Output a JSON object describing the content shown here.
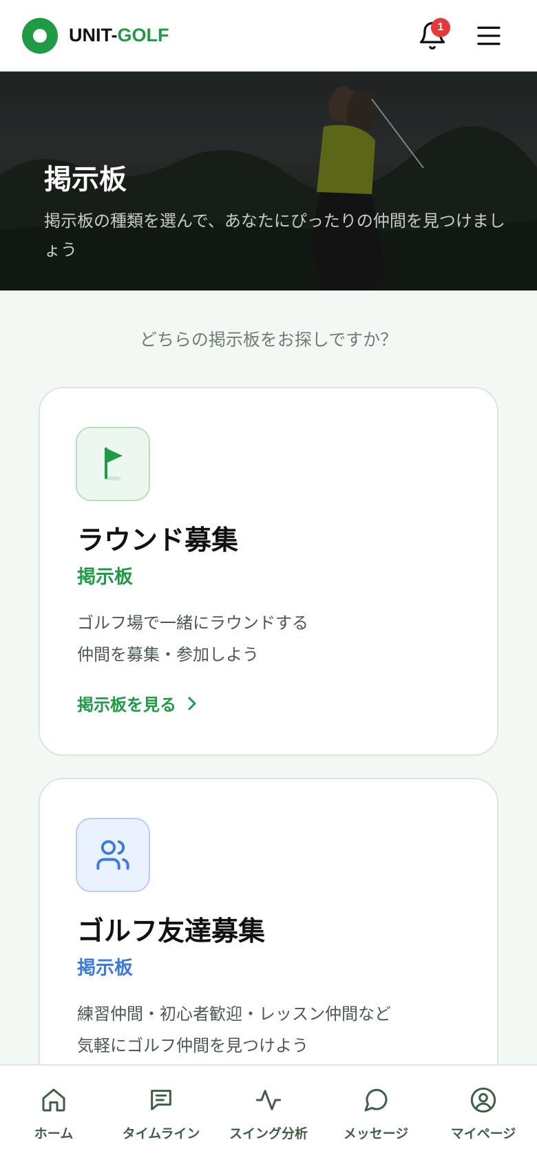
{
  "header": {
    "logo_unit": "UNIT-",
    "logo_golf": "GOLF",
    "notification_count": "1"
  },
  "hero": {
    "title": "掲示板",
    "subtitle": "掲示板の種類を選んで、あなたにぴったりの仲間を見つけましょう"
  },
  "question": "どちらの掲示板をお探しですか？",
  "cards": [
    {
      "title": "ラウンド募集",
      "subtitle": "掲示板",
      "desc_line1": "ゴルフ場で一緒にラウンドする",
      "desc_line2": "仲間を募集・参加しよう",
      "link": "掲示板を見る",
      "icon": "flag-icon",
      "accent": "#1f9a45"
    },
    {
      "title": "ゴルフ友達募集",
      "subtitle": "掲示板",
      "desc_line1": "練習仲間・初心者歓迎・レッスン仲間など",
      "desc_line2": "気軽にゴルフ仲間を見つけよう",
      "icon": "users-icon",
      "accent": "#3b7be0"
    }
  ],
  "bottom_nav": [
    {
      "label": "ホーム",
      "icon": "home-icon"
    },
    {
      "label": "タイムライン",
      "icon": "timeline-icon"
    },
    {
      "label": "スイング分析",
      "icon": "activity-icon"
    },
    {
      "label": "メッセージ",
      "icon": "message-icon"
    },
    {
      "label": "マイページ",
      "icon": "user-circle-icon"
    }
  ],
  "colors": {
    "brand_green": "#1f9a45",
    "badge_red": "#e5383b",
    "friend_blue": "#3b7be0"
  }
}
